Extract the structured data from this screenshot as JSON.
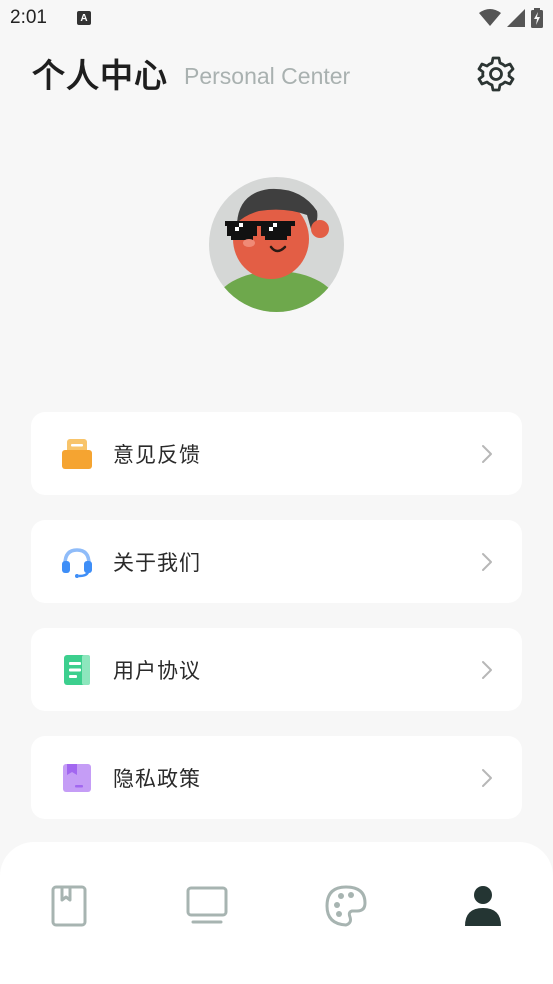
{
  "status_bar": {
    "time": "2:01",
    "notification_letter": "A"
  },
  "header": {
    "title": "个人中心",
    "subtitle": "Personal Center"
  },
  "menu": [
    {
      "label": "意见反馈",
      "icon": "feedback-icon",
      "color": "#f5a431"
    },
    {
      "label": "关于我们",
      "icon": "headset-icon",
      "color": "#3e8ef7"
    },
    {
      "label": "用户协议",
      "icon": "document-icon",
      "color": "#3ccf8e"
    },
    {
      "label": "隐私政策",
      "icon": "privacy-book-icon",
      "color": "#a267f0"
    }
  ],
  "bottom_nav": [
    {
      "name": "bookmark-book-icon",
      "active": false
    },
    {
      "name": "monitor-icon",
      "active": false
    },
    {
      "name": "palette-icon",
      "active": false
    },
    {
      "name": "profile-person-icon",
      "active": true
    }
  ],
  "colors": {
    "inactive_nav": "#a7b4b1",
    "active_nav": "#243533",
    "chevron": "#b7b7b7"
  }
}
